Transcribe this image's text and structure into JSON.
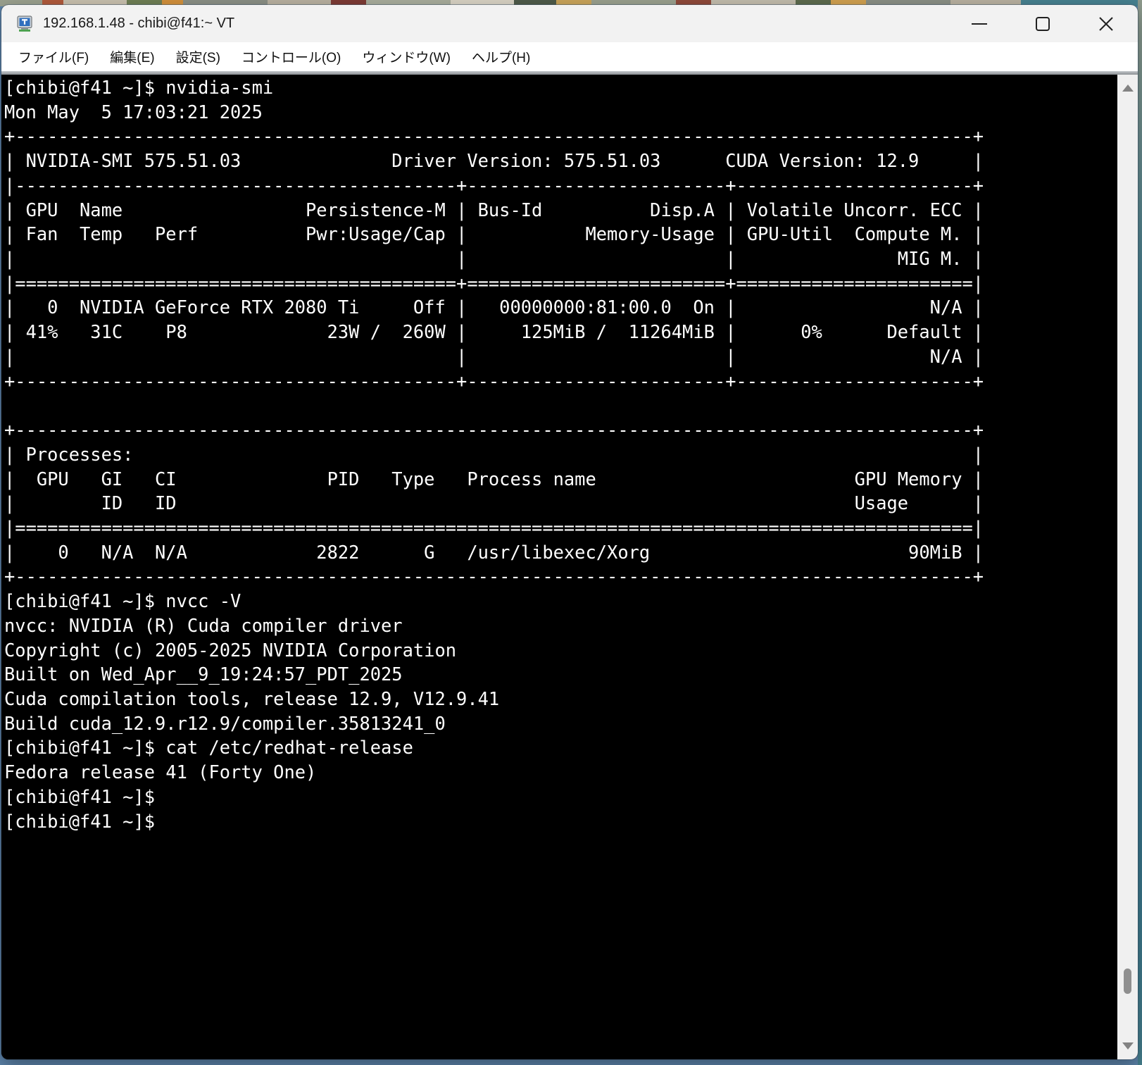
{
  "window": {
    "title": "192.168.1.48 - chibi@f41:~ VT",
    "app_icon": "teraterm-monitor-icon"
  },
  "titlebar_controls": {
    "minimize_icon": "minimize-icon",
    "maximize_icon": "maximize-icon",
    "close_icon": "close-icon"
  },
  "menubar": {
    "items": [
      {
        "label": "ファイル(F)"
      },
      {
        "label": "編集(E)"
      },
      {
        "label": "設定(S)"
      },
      {
        "label": "コントロール(O)"
      },
      {
        "label": "ウィンドウ(W)"
      },
      {
        "label": "ヘルプ(H)"
      }
    ]
  },
  "terminal": {
    "foreground": "#ffffff",
    "background": "#000000",
    "lines": [
      "[chibi@f41 ~]$ nvidia-smi",
      "Mon May  5 17:03:21 2025",
      "+-----------------------------------------------------------------------------------------+",
      "| NVIDIA-SMI 575.51.03              Driver Version: 575.51.03      CUDA Version: 12.9     |",
      "|-----------------------------------------+------------------------+----------------------+",
      "| GPU  Name                 Persistence-M | Bus-Id          Disp.A | Volatile Uncorr. ECC |",
      "| Fan  Temp   Perf          Pwr:Usage/Cap |           Memory-Usage | GPU-Util  Compute M. |",
      "|                                         |                        |               MIG M. |",
      "|=========================================+========================+======================|",
      "|   0  NVIDIA GeForce RTX 2080 Ti     Off |   00000000:81:00.0  On |                  N/A |",
      "| 41%   31C    P8             23W /  260W |     125MiB /  11264MiB |      0%      Default |",
      "|                                         |                        |                  N/A |",
      "+-----------------------------------------+------------------------+----------------------+",
      "",
      "+-----------------------------------------------------------------------------------------+",
      "| Processes:                                                                              |",
      "|  GPU   GI   CI              PID   Type   Process name                        GPU Memory |",
      "|        ID   ID                                                               Usage      |",
      "|=========================================================================================|",
      "|    0   N/A  N/A            2822      G   /usr/libexec/Xorg                        90MiB |",
      "+-----------------------------------------------------------------------------------------+",
      "[chibi@f41 ~]$ nvcc -V",
      "nvcc: NVIDIA (R) Cuda compiler driver",
      "Copyright (c) 2005-2025 NVIDIA Corporation",
      "Built on Wed_Apr__9_19:24:57_PDT_2025",
      "Cuda compilation tools, release 12.9, V12.9.41",
      "Build cuda_12.9.r12.9/compiler.35813241_0",
      "[chibi@f41 ~]$ cat /etc/redhat-release",
      "Fedora release 41 (Forty One)",
      "[chibi@f41 ~]$",
      "[chibi@f41 ~]$"
    ]
  },
  "scrollbar": {
    "up_icon": "scroll-up-arrow-icon",
    "down_icon": "scroll-down-arrow-icon"
  }
}
